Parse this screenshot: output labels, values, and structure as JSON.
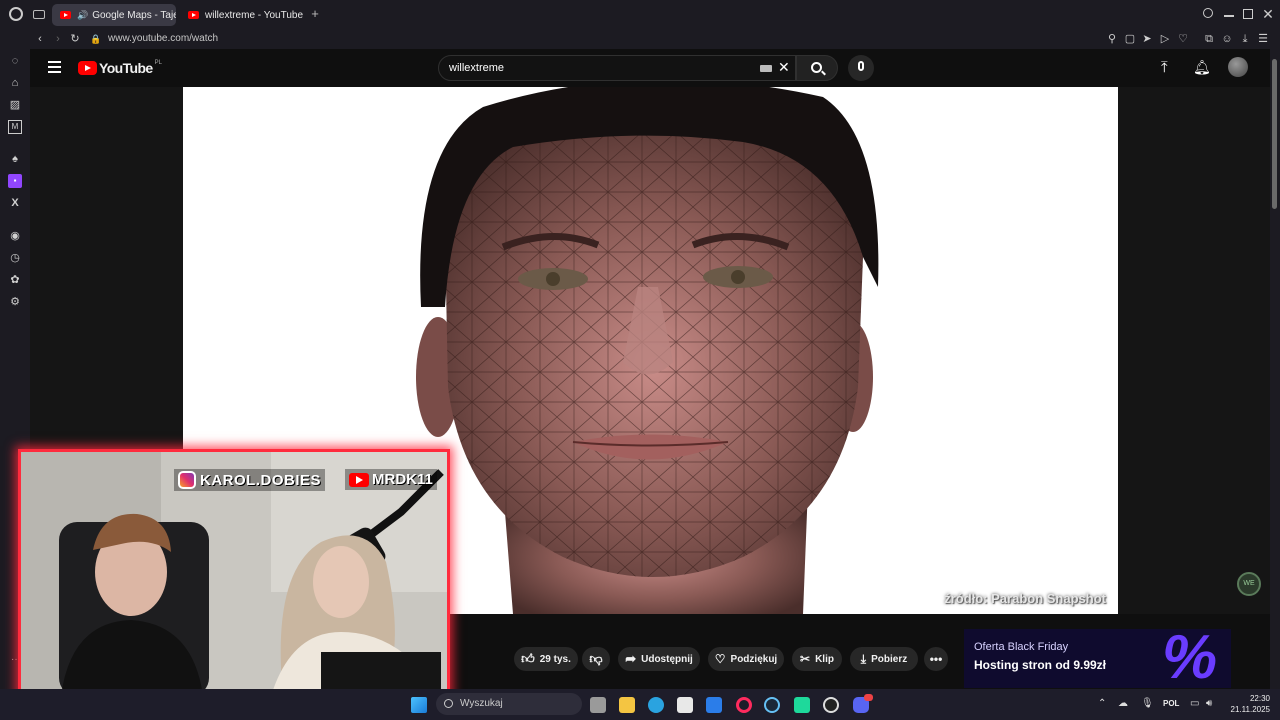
{
  "browser": {
    "tabs": [
      {
        "title": "Google Maps - Tajem"
      },
      {
        "title": "willextreme - YouTube"
      }
    ],
    "url": "www.youtube.com/watch"
  },
  "youtube": {
    "logo": "YouTube",
    "region": "PL",
    "search_value": "willextreme"
  },
  "video": {
    "source_credit": "źródło: Parabon Snapshot"
  },
  "actions": {
    "likes": "29 tys.",
    "share": "Udostępnij",
    "thanks": "Podziękuj",
    "clip": "Klip",
    "download": "Pobierz"
  },
  "ad": {
    "title": "Oferta Black Friday",
    "subtitle": "Hosting stron od 9.99zł"
  },
  "webcam": {
    "instagram": "KAROL.DOBIES",
    "youtube": "MRDK11"
  },
  "taskbar": {
    "search_placeholder": "Wyszukaj",
    "lang": "POL",
    "time": "22:30",
    "date": "21.11.2025"
  },
  "colors": {
    "accent_red": "#ff0000",
    "cam_border": "#ff2b3d",
    "ad_purple": "#6a3cff"
  }
}
